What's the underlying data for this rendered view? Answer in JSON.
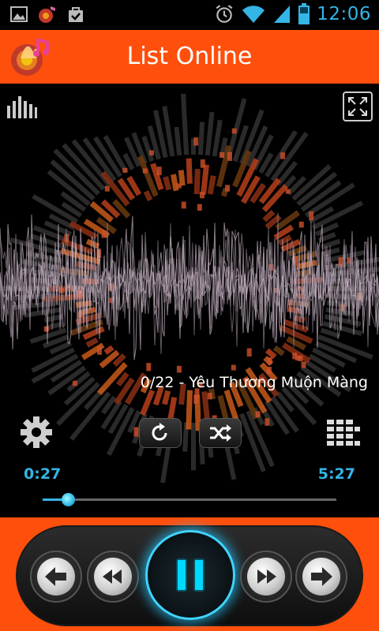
{
  "status_bar": {
    "time": "12:06",
    "icons": [
      "gallery-icon",
      "music-notification-icon",
      "shopping-bag-icon",
      "alarm-icon",
      "wifi-icon",
      "signal-icon",
      "battery-icon"
    ]
  },
  "header": {
    "title": "List Online"
  },
  "player": {
    "song_title": "0/22 - Yêu Thương Muộn Màng",
    "current_time": "0:27",
    "total_time": "5:27",
    "progress_fraction": 0.085
  },
  "colors": {
    "accent": "#33b5e5",
    "header_bg": "#ff4f0c",
    "play_glow": "#3fd4ff"
  }
}
